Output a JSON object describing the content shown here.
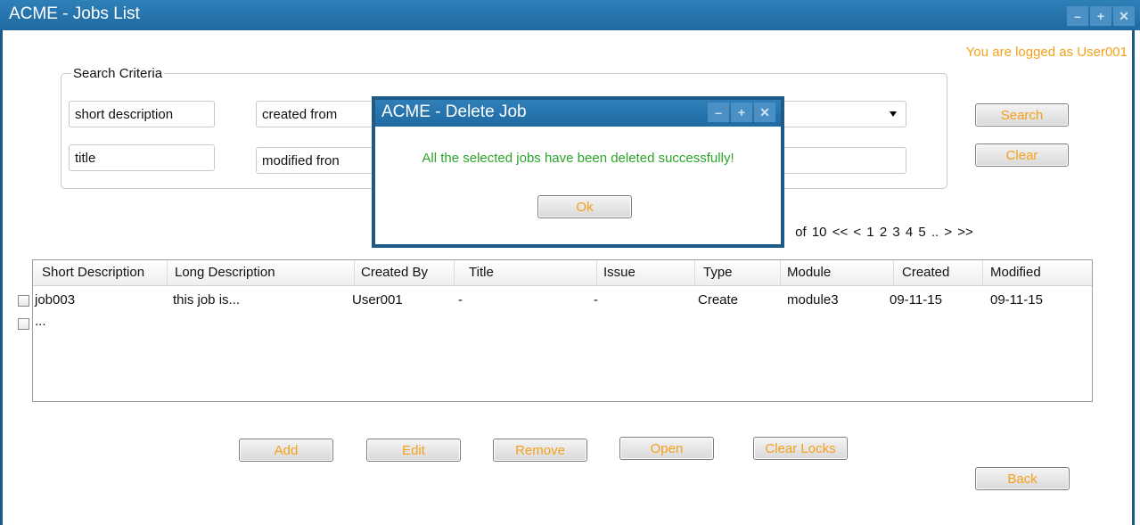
{
  "window": {
    "title": "ACME - Jobs List",
    "controls": [
      "minimize-icon",
      "maximize-icon",
      "close-icon"
    ],
    "logged_as": "You are logged as User001"
  },
  "search": {
    "group_label": "Search Criteria",
    "short_description": "short description",
    "title": "title",
    "created_from": "created from",
    "modified_from": "modified fron",
    "search_label": "Search",
    "clear_label": "Clear"
  },
  "pager": {
    "text": " of 10  <<   <   1   2 3  4  5  ..   >   >>"
  },
  "table": {
    "columns": [
      "Short Description",
      "Long Description",
      "Created By",
      "Title",
      "Issue",
      "Type",
      "Module",
      "Created",
      "Modified"
    ],
    "rows": [
      {
        "short": "job003",
        "long": "this job is...",
        "created_by": "User001",
        "title": "-",
        "issue": "-",
        "type": "Create",
        "module": "module3",
        "created": "09-11-15",
        "modified": "09-11-15"
      },
      {
        "short": "..."
      }
    ]
  },
  "actions": {
    "add": "Add",
    "edit": "Edit",
    "remove": "Remove",
    "open": "Open",
    "clear_locks": "Clear Locks",
    "back": "Back"
  },
  "dialog": {
    "title": "ACME - Delete Job",
    "message": "All the selected jobs have been deleted successfully!",
    "ok_label": "Ok"
  },
  "colors": {
    "titlebar": "#1f6aa3",
    "accent_text": "#f5a01a",
    "success_text": "#2aa52a"
  }
}
